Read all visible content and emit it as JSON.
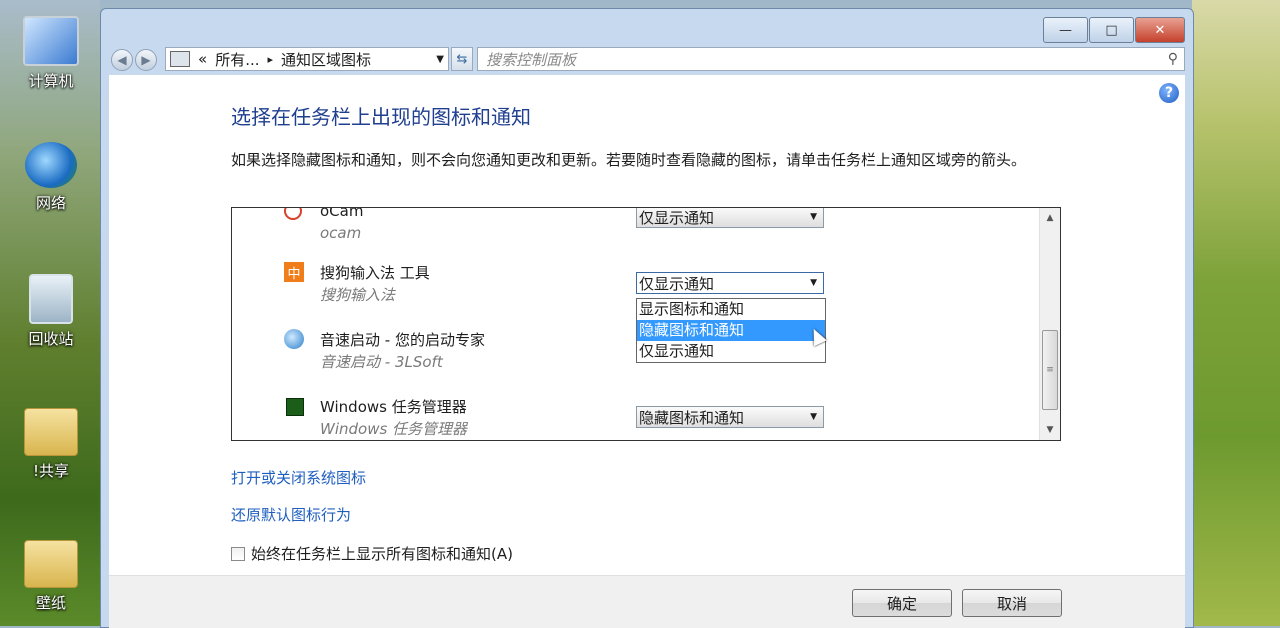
{
  "desktop": {
    "icons": [
      {
        "label": "计算机"
      },
      {
        "label": "网络"
      },
      {
        "label": "回收站"
      },
      {
        "label": "!共享"
      },
      {
        "label": "壁纸"
      }
    ]
  },
  "window": {
    "caption": {
      "minimize": "—",
      "maximize": "□",
      "close": "✕"
    },
    "address": {
      "chevron": "«",
      "crumb1": "所有...",
      "separator": "▸",
      "crumb2": "通知区域图标",
      "search_placeholder": "搜索控制面板"
    },
    "help_label": "?",
    "heading": "选择在任务栏上出现的图标和通知",
    "description": "如果选择隐藏图标和通知，则不会向您通知更改和更新。若要随时查看隐藏的图标，请单击任务栏上通知区域旁的箭头。",
    "rows": [
      {
        "name": "oCam",
        "sub": "ocam",
        "behavior": "仅显示通知",
        "icon": "ocam-icon",
        "icon_color": "#d9412b"
      },
      {
        "name": "搜狗输入法 工具",
        "sub": "搜狗输入法",
        "behavior": "仅显示通知",
        "icon": "sogou-icon",
        "icon_color": "#f07d1a",
        "icon_glyph": "中"
      },
      {
        "name": "音速启动 - 您的启动专家",
        "sub": "音速启动 - 3LSoft",
        "behavior": "",
        "icon": "vstart-icon",
        "icon_color": "#2a7fc9"
      },
      {
        "name": "Windows 任务管理器",
        "sub": "Windows 任务管理器",
        "behavior": "隐藏图标和通知",
        "icon": "taskmgr-icon",
        "icon_color": "#1a5e1a"
      }
    ],
    "dropdown_options": [
      "显示图标和通知",
      "隐藏图标和通知",
      "仅显示通知"
    ],
    "dropdown_selected_index": 1,
    "links": {
      "system_icons": "打开或关闭系统图标",
      "restore_defaults": "还原默认图标行为"
    },
    "always_show": {
      "label": "始终在任务栏上显示所有图标和通知(A)",
      "checked": false
    },
    "buttons": {
      "ok": "确定",
      "cancel": "取消"
    }
  }
}
